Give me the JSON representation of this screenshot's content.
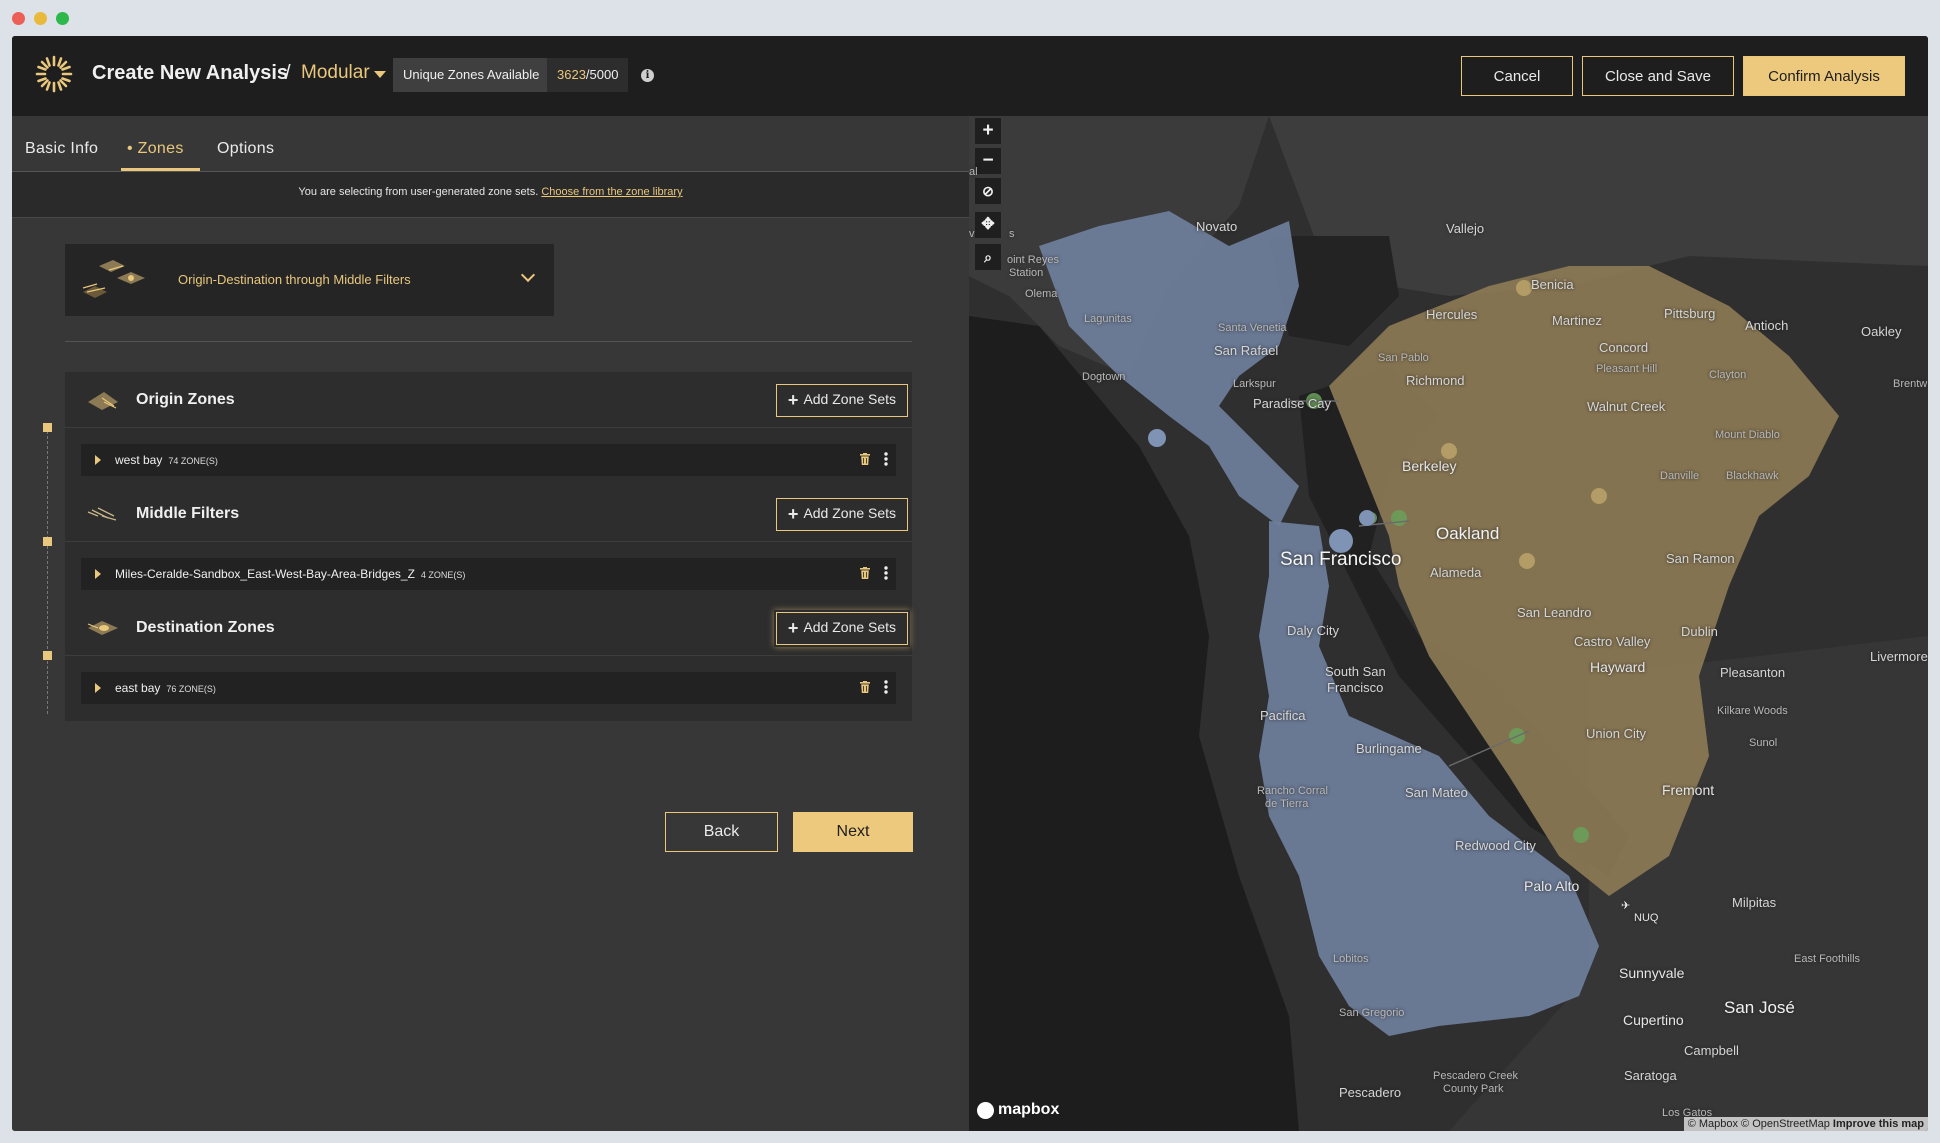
{
  "window": {
    "dots": [
      "#ec5f57",
      "#e9b93c",
      "#2eb74a"
    ]
  },
  "header": {
    "title": "Create New Analysis",
    "separator": "/",
    "mode": "Modular",
    "unique_zones_label": "Unique Zones Available",
    "zones_used": "3623",
    "zones_total": "/5000",
    "info_icon": "info-icon",
    "cancel": "Cancel",
    "close_save": "Close and Save",
    "confirm": "Confirm Analysis"
  },
  "tabs": [
    {
      "label": "Basic Info",
      "active": false
    },
    {
      "label": "• Zones",
      "active": true
    },
    {
      "label": "Options",
      "active": false
    }
  ],
  "notice": {
    "text": "You are selecting from user-generated zone sets.",
    "link": "Choose from the zone library"
  },
  "analysis_type": {
    "label": "Origin-Destination through Middle Filters"
  },
  "sections": [
    {
      "title": "Origin Zones",
      "add": "Add Zone Sets",
      "row": {
        "name": "west bay",
        "count": "74 ZONE(S)"
      }
    },
    {
      "title": "Middle Filters",
      "add": "Add Zone Sets",
      "row": {
        "name": "Miles-Ceralde-Sandbox_East-West-Bay-Area-Bridges_Z",
        "count": "4 ZONE(S)"
      }
    },
    {
      "title": "Destination Zones",
      "add": "Add Zone Sets",
      "row": {
        "name": "east bay",
        "count": "76 ZONE(S)"
      }
    }
  ],
  "nav": {
    "back": "Back",
    "next": "Next"
  },
  "map": {
    "controls": [
      "+",
      "−",
      "compass-icon",
      "move-icon",
      "search-icon"
    ],
    "labels": {
      "novato": "Novato",
      "vallejo": "Vallejo",
      "point_reyes": "oint Reyes",
      "station": "Station",
      "olema": "Olema",
      "benicia": "Benicia",
      "hercules": "Hercules",
      "martinez": "Martinez",
      "pittsburg": "Pittsburg",
      "antioch": "Antioch",
      "oakley": "Oakley",
      "lagunitas": "Lagunitas",
      "santa_venetia": "Santa Venetia",
      "san_rafael": "San Rafael",
      "dogtown": "Dogtown",
      "san_pablo": "San Pablo",
      "concord": "Concord",
      "pleasant_hill": "Pleasant Hill",
      "clayton": "Clayton",
      "brentwood": "Brentw",
      "larkspur": "Larkspur",
      "richmond": "Richmond",
      "paradise_cay": "Paradise Cay",
      "walnut_creek": "Walnut Creek",
      "mount_diablo": "Mount Diablo",
      "berkeley": "Berkeley",
      "danville": "Danville",
      "blackhawk": "Blackhawk",
      "oakland": "Oakland",
      "san_francisco": "San Francisco",
      "alameda": "Alameda",
      "san_ramon": "San Ramon",
      "san_leandro": "San Leandro",
      "daly_city": "Daly City",
      "castro_valley": "Castro Valley",
      "dublin": "Dublin",
      "livermore": "Livermore",
      "south_sf1": "South San",
      "south_sf2": "Francisco",
      "hayward": "Hayward",
      "pleasanton": "Pleasanton",
      "pacifica": "Pacifica",
      "kilkare": "Kilkare Woods",
      "union_city": "Union City",
      "sunol": "Sunol",
      "burlingame": "Burlingame",
      "rancho1": "Rancho Corral",
      "rancho2": "de Tierra",
      "san_mateo": "San Mateo",
      "fremont": "Fremont",
      "redwood_city": "Redwood City",
      "palo_alto": "Palo Alto",
      "milpitas": "Milpitas",
      "nuq": "NUQ",
      "lobitos": "Lobitos",
      "east_foothills": "East Foothills",
      "sunnyvale": "Sunnyvale",
      "san_gregorio": "San Gregorio",
      "cupertino": "Cupertino",
      "san_jose": "San José",
      "campbell": "Campbell",
      "pescadero_creek1": "Pescadero Creek",
      "pescadero_creek2": "County Park",
      "saratoga": "Saratoga",
      "pescadero": "Pescadero",
      "los_gatos": "Los Gatos",
      "al": "al",
      "vs": "v",
      "s": "s"
    },
    "mapbox": "mapbox",
    "attribution": "© Mapbox © OpenStreetMap",
    "improve": "Improve this map",
    "colors": {
      "west": "#6f7f9c",
      "east": "#8c7a55",
      "filter": "#6aa05a"
    }
  }
}
